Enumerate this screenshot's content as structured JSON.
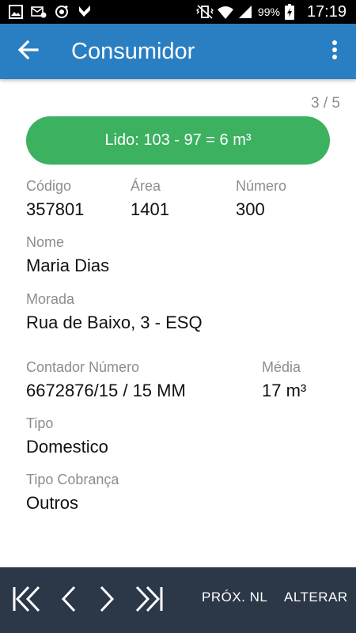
{
  "status_bar": {
    "battery_percent": "99%",
    "time": "17:19",
    "left_icons": [
      "gallery-icon",
      "email-alert-icon",
      "sync-icon",
      "download-done-icon"
    ],
    "right_icons": [
      "vibrate-icon",
      "wifi-icon",
      "signal-icon",
      "battery-icon"
    ]
  },
  "appbar": {
    "title": "Consumidor",
    "background": "#2a7fc2"
  },
  "pager": {
    "text": "3 / 5"
  },
  "reading": {
    "label": "Lido: 103 - 97 = 6 m³",
    "color": "#3cb160"
  },
  "fields": {
    "codigo": {
      "label": "Código",
      "value": "357801"
    },
    "area": {
      "label": "Área",
      "value": "1401"
    },
    "numero": {
      "label": "Número",
      "value": "300"
    },
    "nome": {
      "label": "Nome",
      "value": "Maria Dias"
    },
    "morada": {
      "label": "Morada",
      "value": "Rua de Baixo, 3 - ESQ"
    },
    "contador": {
      "label": "Contador Número",
      "value": "6672876/15 / 15 MM"
    },
    "media": {
      "label": "Média",
      "value": "17 m³"
    },
    "tipo": {
      "label": "Tipo",
      "value": "Domestico"
    },
    "tipo_cobranca": {
      "label": "Tipo Cobrança",
      "value": "Outros"
    }
  },
  "bottom_bar": {
    "background": "#2c3848",
    "nav_icons": [
      "first-page-icon",
      "previous-icon",
      "next-icon",
      "last-page-icon"
    ],
    "next_nl_label": "PRÓX. NL",
    "alter_label": "ALTERAR"
  }
}
